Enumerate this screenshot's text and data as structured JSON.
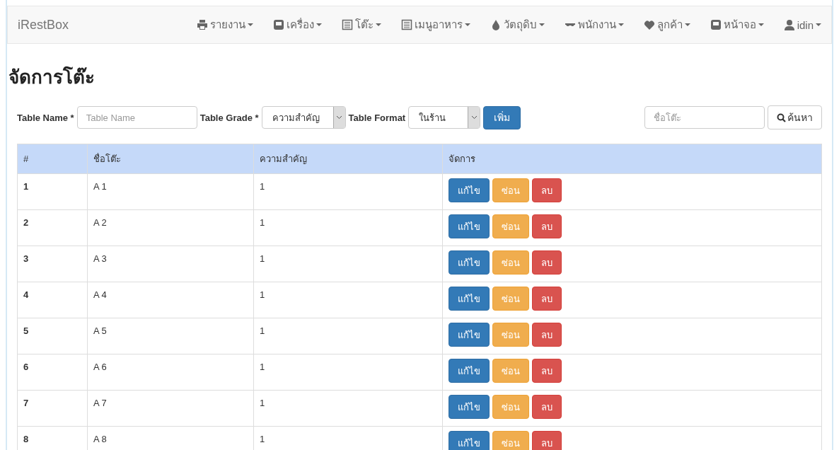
{
  "navbar": {
    "brand": "iRestBox",
    "menus": [
      {
        "label": "รายงาน"
      },
      {
        "label": "เครื่อง"
      },
      {
        "label": "โต๊ะ"
      },
      {
        "label": "เมนูอาหาร"
      },
      {
        "label": "วัตถุดิบ"
      },
      {
        "label": "พนักงาน"
      },
      {
        "label": "ลูกค้า"
      },
      {
        "label": "หน้าจอ"
      },
      {
        "label": "idin"
      }
    ]
  },
  "page_title": "จัดการโต๊ะ",
  "form": {
    "table_name": {
      "label": "Table Name *",
      "placeholder": "Table Name"
    },
    "table_grade": {
      "label": "Table Grade *",
      "value": "ความสำคัญ"
    },
    "table_format": {
      "label": "Table Format",
      "value": "ในร้าน"
    },
    "add_button": "เพิ่ม",
    "search": {
      "placeholder": "ชื่อโต๊ะ"
    },
    "search_button": "ค้นหา"
  },
  "table": {
    "columns": [
      "#",
      "ชื่อโต๊ะ",
      "ความสำคัญ",
      "จัดการ"
    ],
    "rows": [
      {
        "number": "1",
        "name": "A 1",
        "grade": "1",
        "actions": [
          {
            "kind": "edit",
            "label": "แก้ไข"
          },
          {
            "kind": "hide",
            "label": "ซ่อน"
          },
          {
            "kind": "delete",
            "label": "ลบ"
          }
        ]
      },
      {
        "number": "2",
        "name": "A 2",
        "grade": "1",
        "actions": [
          {
            "kind": "edit",
            "label": "แก้ไข"
          },
          {
            "kind": "hide",
            "label": "ซ่อน"
          },
          {
            "kind": "delete",
            "label": "ลบ"
          }
        ]
      },
      {
        "number": "3",
        "name": "A 3",
        "grade": "1",
        "actions": [
          {
            "kind": "edit",
            "label": "แก้ไข"
          },
          {
            "kind": "hide",
            "label": "ซ่อน"
          },
          {
            "kind": "delete",
            "label": "ลบ"
          }
        ]
      },
      {
        "number": "4",
        "name": "A 4",
        "grade": "1",
        "actions": [
          {
            "kind": "edit",
            "label": "แก้ไข"
          },
          {
            "kind": "hide",
            "label": "ซ่อน"
          },
          {
            "kind": "delete",
            "label": "ลบ"
          }
        ]
      },
      {
        "number": "5",
        "name": "A 5",
        "grade": "1",
        "actions": [
          {
            "kind": "edit",
            "label": "แก้ไข"
          },
          {
            "kind": "hide",
            "label": "ซ่อน"
          },
          {
            "kind": "delete",
            "label": "ลบ"
          }
        ]
      },
      {
        "number": "6",
        "name": "A 6",
        "grade": "1",
        "actions": [
          {
            "kind": "edit",
            "label": "แก้ไข"
          },
          {
            "kind": "hide",
            "label": "ซ่อน"
          },
          {
            "kind": "delete",
            "label": "ลบ"
          }
        ]
      },
      {
        "number": "7",
        "name": "A 7",
        "grade": "1",
        "actions": [
          {
            "kind": "edit",
            "label": "แก้ไข"
          },
          {
            "kind": "hide",
            "label": "ซ่อน"
          },
          {
            "kind": "delete",
            "label": "ลบ"
          }
        ]
      },
      {
        "number": "8",
        "name": "A 8",
        "grade": "1",
        "actions": [
          {
            "kind": "edit",
            "label": "แก้ไข"
          },
          {
            "kind": "hide",
            "label": "ซ่อน"
          },
          {
            "kind": "delete",
            "label": "ลบ"
          }
        ]
      }
    ]
  }
}
